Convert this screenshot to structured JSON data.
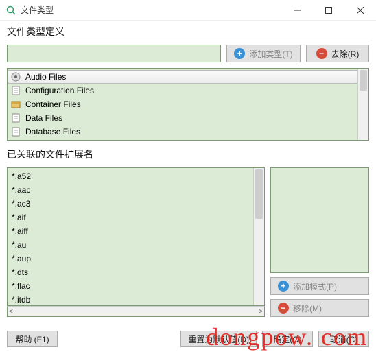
{
  "window": {
    "title": "文件类型"
  },
  "section1": {
    "label": "文件类型定义",
    "input_value": "",
    "add_button": "添加类型(T)",
    "remove_button": "去除(R)"
  },
  "types": [
    {
      "label": "Audio Files",
      "icon": "audio"
    },
    {
      "label": "Configuration Files",
      "icon": "config"
    },
    {
      "label": "Container Files",
      "icon": "container"
    },
    {
      "label": "Data Files",
      "icon": "data"
    },
    {
      "label": "Database Files",
      "icon": "database"
    }
  ],
  "section2": {
    "label": "已关联的文件扩展名",
    "input_value": "",
    "add_button": "添加模式(P)",
    "remove_button": "移除(M)"
  },
  "extensions": [
    "*.a52",
    "*.aac",
    "*.ac3",
    "*.aif",
    "*.aiff",
    "*.au",
    "*.aup",
    "*.dts",
    "*.flac",
    "*.itdb"
  ],
  "footer": {
    "help": "帮助 (F1)",
    "reset": "重置为默认值(D)",
    "ok": "确定(O)",
    "cancel": "取消(C)"
  },
  "watermark": "dongpow. com"
}
